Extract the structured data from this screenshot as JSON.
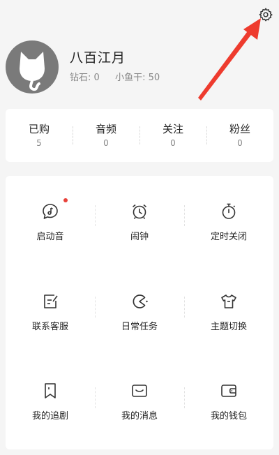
{
  "profile": {
    "username": "八百江月",
    "diamond_label": "钻石:",
    "diamond_value": "0",
    "fish_label": "小鱼干:",
    "fish_value": "50"
  },
  "counts": [
    {
      "label": "已购",
      "value": "5"
    },
    {
      "label": "音频",
      "value": "0"
    },
    {
      "label": "关注",
      "value": "0"
    },
    {
      "label": "粉丝",
      "value": "0"
    }
  ],
  "menu": [
    {
      "label": "启动音",
      "icon": "music-chat-icon"
    },
    {
      "label": "闹钟",
      "icon": "alarm-clock-icon"
    },
    {
      "label": "定时关闭",
      "icon": "timer-icon"
    },
    {
      "label": "联系客服",
      "icon": "edit-note-icon"
    },
    {
      "label": "日常任务",
      "icon": "pacman-icon"
    },
    {
      "label": "主题切换",
      "icon": "tshirt-icon"
    },
    {
      "label": "我的追剧",
      "icon": "bookmark-icon"
    },
    {
      "label": "我的消息",
      "icon": "message-icon"
    },
    {
      "label": "我的钱包",
      "icon": "wallet-icon"
    }
  ],
  "colors": {
    "background": "#f5f5f5",
    "card": "#ffffff",
    "text": "#222222",
    "muted": "#888888",
    "arrow": "#ee3b2e",
    "badge": "#e8413a"
  }
}
